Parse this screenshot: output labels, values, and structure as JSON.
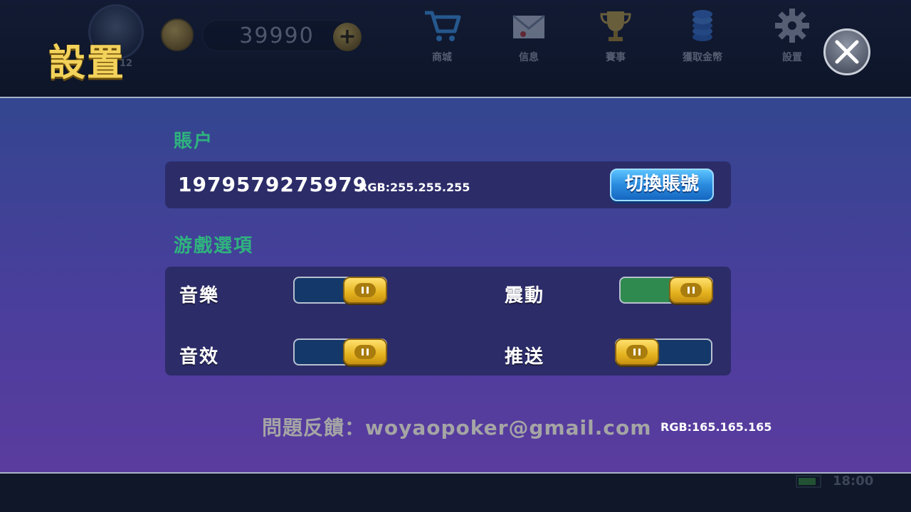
{
  "header": {
    "title": "設置",
    "level": "12",
    "coins": "39990",
    "nav": [
      {
        "label": "商城",
        "icon": "shopping-cart-icon"
      },
      {
        "label": "信息",
        "icon": "mail-icon"
      },
      {
        "label": "賽事",
        "icon": "trophy-icon"
      },
      {
        "label": "獲取金幣",
        "icon": "chip-stack-icon"
      },
      {
        "label": "設置",
        "icon": "gear-icon"
      }
    ]
  },
  "account": {
    "section_title": "賬户",
    "user_id": "1979579275979",
    "rgb_note": "RGB:255.255.255",
    "switch_button": "切換賬號"
  },
  "options": {
    "section_title": "游戲選項",
    "music": {
      "label": "音樂",
      "state": "off"
    },
    "vibration": {
      "label": "震動",
      "state": "on"
    },
    "sound_effects": {
      "label": "音效",
      "state": "off"
    },
    "push": {
      "label": "推送",
      "state": "off"
    }
  },
  "feedback": {
    "text": "問題反饋：woyaopoker@gmail.com",
    "rgb_note": "RGB:165.165.165"
  },
  "status_bar": {
    "time": "18:00"
  },
  "colors": {
    "title_gold": "#f3d25b",
    "section_green": "#2fb37e",
    "toggle_on": "#2e8a4f",
    "toggle_off": "#14386a",
    "feedback_grey": "#a5a5a5"
  }
}
